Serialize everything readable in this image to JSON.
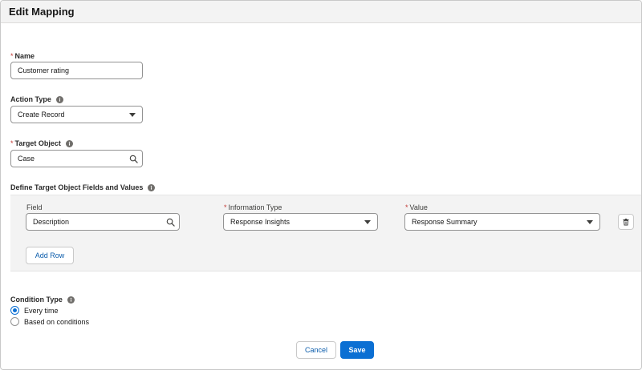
{
  "header": {
    "title": "Edit Mapping"
  },
  "name_field": {
    "label": "Name",
    "value": "Customer rating"
  },
  "action_type": {
    "label": "Action Type",
    "value": "Create Record"
  },
  "target_object": {
    "label": "Target Object",
    "value": "Case"
  },
  "fields_section": {
    "label": "Define Target Object Fields and Values",
    "row": {
      "field_label": "Field",
      "field_value": "Description",
      "info_type_label": "Information Type",
      "info_type_value": "Response Insights",
      "value_label": "Value",
      "value_value": "Response Summary"
    },
    "add_row_label": "Add Row"
  },
  "condition": {
    "label": "Condition Type",
    "options": [
      {
        "label": "Every time",
        "checked": true
      },
      {
        "label": "Based on conditions",
        "checked": false
      }
    ]
  },
  "footer": {
    "cancel_label": "Cancel",
    "save_label": "Save"
  },
  "colors": {
    "brand": "#0b6fd3",
    "required": "#c23934",
    "header_bg": "#f3f3f3"
  }
}
